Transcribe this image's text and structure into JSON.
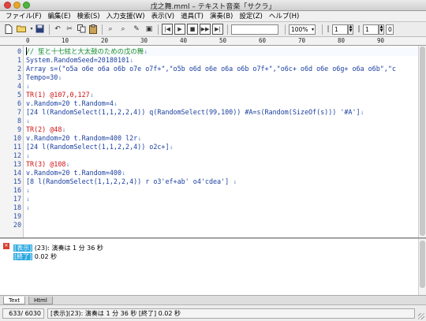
{
  "window": {
    "title": "戊之舞.mml – テキスト音楽「サクラ」"
  },
  "menu": [
    "ファイル(F)",
    "編集(E)",
    "検索(S)",
    "入力支援(W)",
    "表示(V)",
    "道具(T)",
    "演奏(B)",
    "設定(Z)",
    "ヘルプ(H)"
  ],
  "toolbar": {
    "play_icons": [
      "|◀",
      "▶",
      "■",
      "▶▶",
      "▶|",
      "▮▮"
    ],
    "zoom_value": "100%",
    "spin1": "1",
    "spin2": "1",
    "spin3": "0"
  },
  "ruler": {
    "marks": [
      "0",
      "10",
      "20",
      "30",
      "40",
      "50",
      "60",
      "70",
      "80",
      "90"
    ]
  },
  "editor": {
    "lines": [
      {
        "n": "0",
        "parts": [
          {
            "t": "// 笙と十七絃と大太鼓のための戊の舞",
            "c": "comment"
          },
          {
            "t": "↓",
            "c": "eol"
          }
        ]
      },
      {
        "n": "1",
        "parts": [
          {
            "t": "System.RandomSeed=20180101",
            "c": ""
          },
          {
            "t": "↓",
            "c": "eol"
          }
        ]
      },
      {
        "n": "2",
        "parts": [
          {
            "t": "Array s=(\"o5a o6e o6a o6b o7e o7f+\",\"o5b o6d o6e o6a o6b o7f+\",\"o6c+ o6d o6e o6g+ o6a o6b\",\"c",
            "c": ""
          }
        ]
      },
      {
        "n": "3",
        "parts": [
          {
            "t": "Tempo=30",
            "c": ""
          },
          {
            "t": "↓",
            "c": "eol"
          }
        ]
      },
      {
        "n": "4",
        "parts": [
          {
            "t": "↓",
            "c": "eol"
          }
        ]
      },
      {
        "n": "5",
        "parts": [
          {
            "t": "TR(1) @107,0,127",
            "c": "red"
          },
          {
            "t": "↓",
            "c": "eol"
          }
        ]
      },
      {
        "n": "6",
        "parts": [
          {
            "t": "v.Random=20 t.Random=4",
            "c": ""
          },
          {
            "t": "↓",
            "c": "eol"
          }
        ]
      },
      {
        "n": "7",
        "parts": [
          {
            "t": "[24 l(RandomSelect(1,1,2,2,4)) q(RandomSelect(99,100)) #A=s(Random(SizeOf(s))) '#A']",
            "c": ""
          },
          {
            "t": "↓",
            "c": "eol"
          }
        ]
      },
      {
        "n": "8",
        "parts": [
          {
            "t": "↓",
            "c": "eol"
          }
        ]
      },
      {
        "n": "9",
        "parts": [
          {
            "t": "TR(2) @48",
            "c": "red"
          },
          {
            "t": "↓",
            "c": "eol"
          }
        ]
      },
      {
        "n": "10",
        "parts": [
          {
            "t": "v.Random=20 t.Random=400 l2r",
            "c": ""
          },
          {
            "t": "↓",
            "c": "eol"
          }
        ]
      },
      {
        "n": "11",
        "parts": [
          {
            "t": "[24 l(RandomSelect(1,1,2,2,4)) o2c+]",
            "c": ""
          },
          {
            "t": "↓",
            "c": "eol"
          }
        ]
      },
      {
        "n": "12",
        "parts": [
          {
            "t": "↓",
            "c": "eol"
          }
        ]
      },
      {
        "n": "13",
        "parts": [
          {
            "t": "TR(3) @108",
            "c": "red"
          },
          {
            "t": "↓",
            "c": "eol"
          }
        ]
      },
      {
        "n": "14",
        "parts": [
          {
            "t": "v.Random=20 t.Random=400",
            "c": ""
          },
          {
            "t": "↓",
            "c": "eol"
          }
        ]
      },
      {
        "n": "15",
        "parts": [
          {
            "t": "[8 l(RandomSelect(1,1,2,2,4)) r o3'ef+ab' o4'cdea'] ",
            "c": ""
          },
          {
            "t": "↓",
            "c": "eol"
          }
        ]
      },
      {
        "n": "16",
        "parts": [
          {
            "t": "↓",
            "c": "eol"
          }
        ]
      },
      {
        "n": "17",
        "parts": [
          {
            "t": "↓",
            "c": "eol"
          }
        ]
      },
      {
        "n": "18",
        "parts": [
          {
            "t": "↓",
            "c": "eol"
          }
        ]
      },
      {
        "n": "19",
        "parts": [
          {
            "t": "",
            "c": ""
          }
        ]
      },
      {
        "n": "20",
        "parts": [
          {
            "t": "",
            "c": ""
          }
        ]
      }
    ]
  },
  "output": {
    "lines": [
      {
        "tag": "[表示]",
        "text": " (23): 演奏は 1 分 36 秒"
      },
      {
        "tag": "[終了]",
        "text": " 0.02 秒"
      }
    ]
  },
  "tabs": [
    "Text",
    "Html"
  ],
  "status": {
    "position": "633/ 6030",
    "message": "[表示](23): 演奏は 1 分 36 秒 [終了] 0.02 秒"
  },
  "colors": {
    "comment": "#1e8f2c",
    "track": "#d01010",
    "code": "#1a3fa0",
    "tag": "#2aa8e0"
  }
}
